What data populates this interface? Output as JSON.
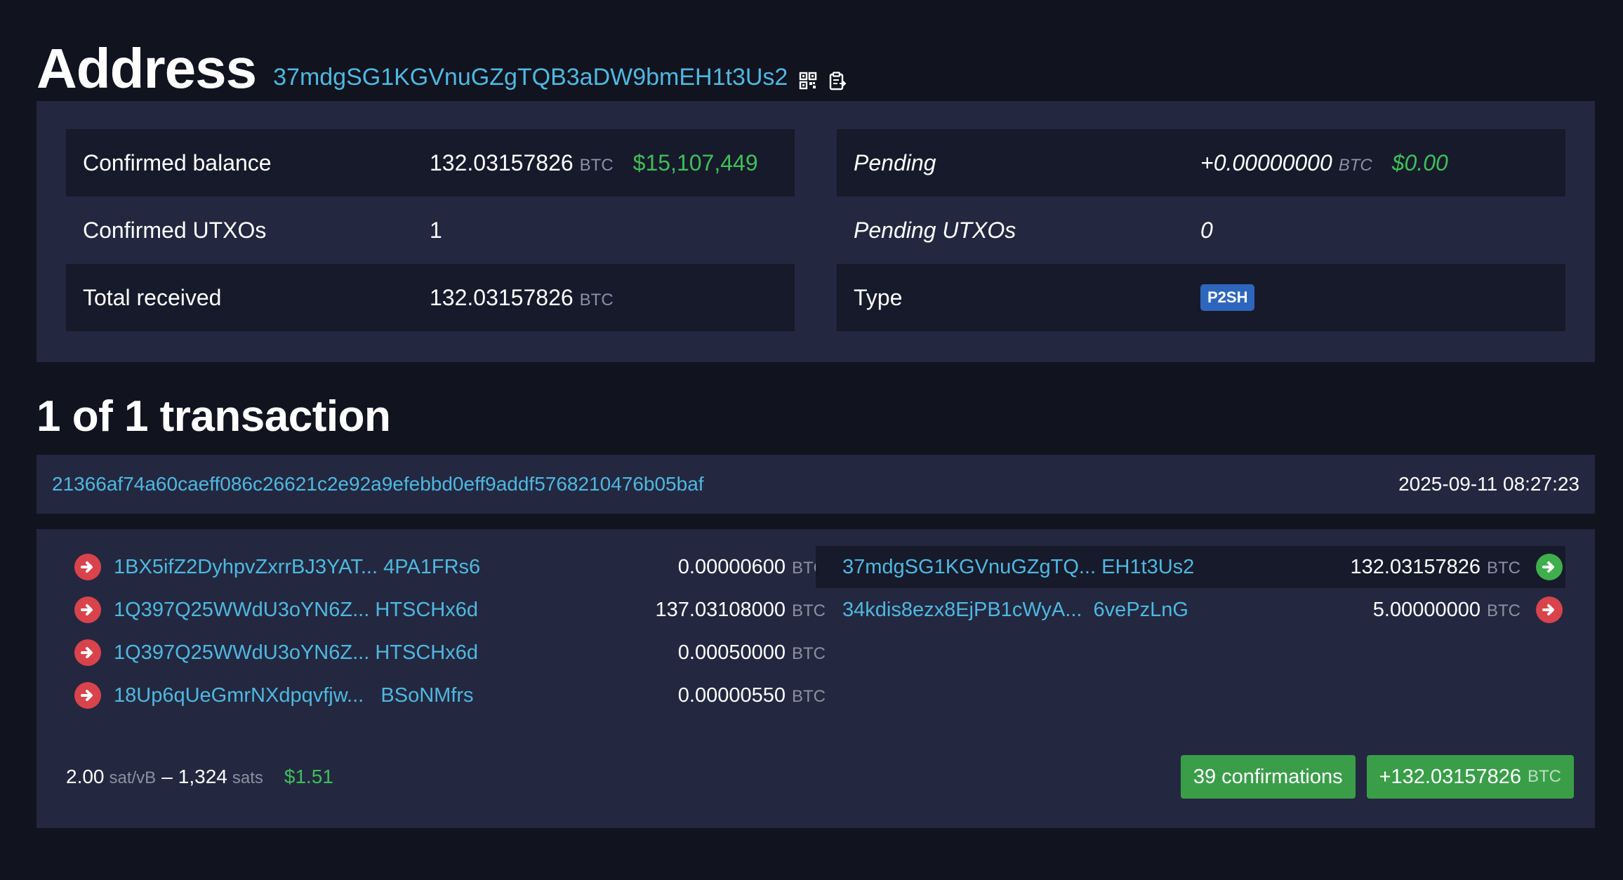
{
  "header": {
    "title": "Address",
    "address": "37mdgSG1KGVnuGZgTQB3aDW9bmEH1t3Us2",
    "qr_icon": "qr-code-icon",
    "copy_icon": "clipboard-copy-icon"
  },
  "summary": {
    "confirmed_balance": {
      "label": "Confirmed balance",
      "value": "132.03157826",
      "unit": "BTC",
      "fiat": "$15,107,449"
    },
    "confirmed_utxos": {
      "label": "Confirmed UTXOs",
      "value": "1"
    },
    "total_received": {
      "label": "Total received",
      "value": "132.03157826",
      "unit": "BTC"
    },
    "pending": {
      "label": "Pending",
      "value": "+0.00000000",
      "unit": "BTC",
      "fiat": "$0.00"
    },
    "pending_utxos": {
      "label": "Pending UTXOs",
      "value": "0"
    },
    "type": {
      "label": "Type",
      "value": "P2SH"
    }
  },
  "transactions": {
    "count_label": "1 of 1 transaction",
    "txid": "21366af74a60caeff086c26621c2e92a9efebbd0eff9addf5768210476b05baf",
    "time": "2025-09-11 08:27:23",
    "inputs": [
      {
        "address": "1BX5ifZ2DyhpvZxrrBJ3YAT... 4PA1FRs6",
        "amount": "0.00000600",
        "unit": "BTC",
        "icon": "arrow-right-circle-red-icon"
      },
      {
        "address": "1Q397Q25WWdU3oYN6Z... HTSCHx6d",
        "amount": "137.03108000",
        "unit": "BTC",
        "icon": "arrow-right-circle-red-icon"
      },
      {
        "address": "1Q397Q25WWdU3oYN6Z... HTSCHx6d",
        "amount": "0.00050000",
        "unit": "BTC",
        "icon": "arrow-right-circle-red-icon"
      },
      {
        "address": "18Up6qUeGmrNXdpqvfjw...   BSoNMfrs",
        "amount": "0.00000550",
        "unit": "BTC",
        "icon": "arrow-right-circle-red-icon"
      }
    ],
    "outputs": [
      {
        "address": "37mdgSG1KGVnuGZgTQ... EH1t3Us2",
        "amount": "132.03157826",
        "unit": "BTC",
        "icon": "arrow-right-circle-green-icon"
      },
      {
        "address": "34kdis8ezx8EjPB1cWyA...  6vePzLnG",
        "amount": "5.00000000",
        "unit": "BTC",
        "icon": "arrow-right-circle-red-icon"
      }
    ],
    "fee": {
      "rate": "2.00",
      "rate_unit": "sat/vB",
      "separator": "–",
      "sats": "1,324",
      "sats_unit": "sats",
      "fiat": "$1.51"
    },
    "confirmations_label": "39 confirmations",
    "net_amount": "+132.03157826",
    "net_unit": "BTC"
  },
  "colors": {
    "background": "#11131f",
    "panel": "#232840",
    "link": "#4fb8e0",
    "fiat": "#3fbf58",
    "badge": "#2f66bd",
    "button": "#3a9e49",
    "input_arrow": "#d9434b",
    "output_arrow_self": "#3fae4c"
  }
}
